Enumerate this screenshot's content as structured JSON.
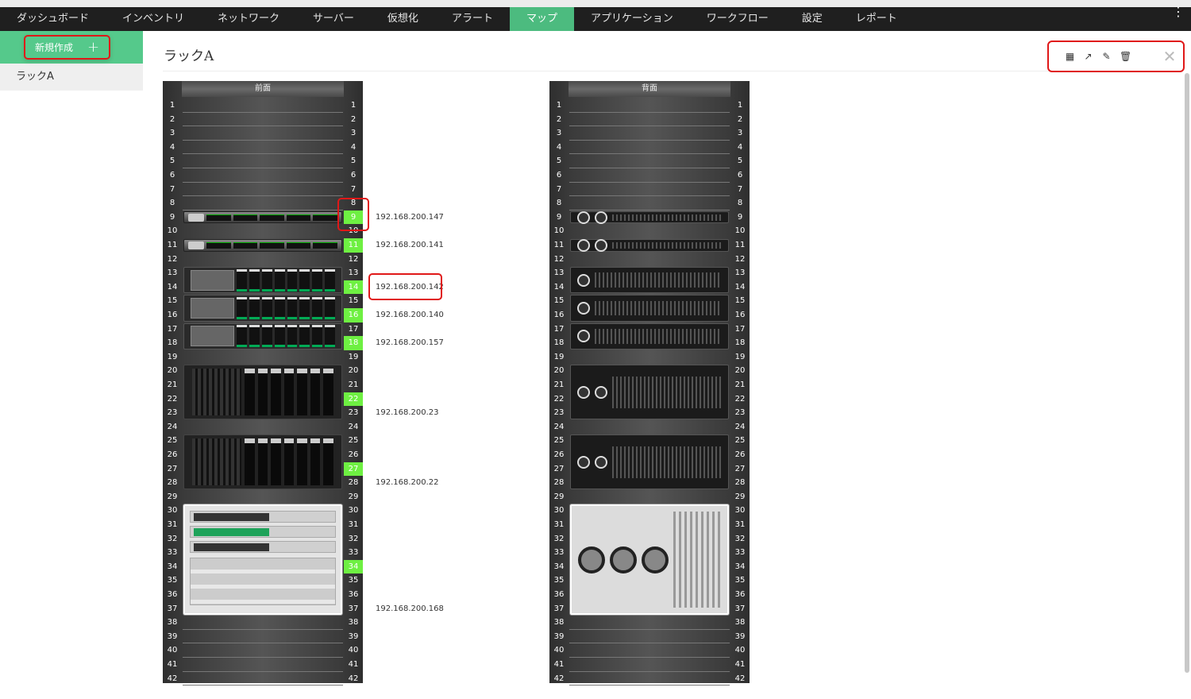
{
  "nav": {
    "items": [
      "ダッシュボード",
      "インベントリ",
      "ネットワーク",
      "サーバー",
      "仮想化",
      "アラート",
      "マップ",
      "アプリケーション",
      "ワークフロー",
      "設定",
      "レポート"
    ],
    "active": "マップ",
    "more_icon": "vertical-ellipsis-icon"
  },
  "sidebar": {
    "new_label": "新規作成",
    "new_icon": "plus-icon",
    "items": [
      "ラックA"
    ]
  },
  "page": {
    "title": "ラックA"
  },
  "toolbar": {
    "icons": [
      "grid-icon",
      "expand-arrow-icon",
      "edit-icon",
      "trash-icon",
      "close-icon"
    ]
  },
  "colors": {
    "accent": "#4cbb7f",
    "highlight": "#6ef042",
    "annotation": "#e01818"
  },
  "racks": [
    {
      "label": "前面",
      "units": 42,
      "highlighted_units": [
        9,
        11,
        14,
        16,
        18,
        22,
        27,
        34
      ],
      "devices": [
        {
          "start": 9,
          "size": 1,
          "type": "1u",
          "ip": "192.168.200.147",
          "ip_unit": 9
        },
        {
          "start": 11,
          "size": 1,
          "type": "1u",
          "ip": "192.168.200.141",
          "ip_unit": 11
        },
        {
          "start": 13,
          "size": 2,
          "type": "2u",
          "ip": "192.168.200.142",
          "ip_unit": 14
        },
        {
          "start": 15,
          "size": 2,
          "type": "2u",
          "ip": "192.168.200.140",
          "ip_unit": 16
        },
        {
          "start": 17,
          "size": 2,
          "type": "2u",
          "ip": "192.168.200.157",
          "ip_unit": 18
        },
        {
          "start": 20,
          "size": 4,
          "type": "4u",
          "ip": "192.168.200.23",
          "ip_unit": 23
        },
        {
          "start": 25,
          "size": 4,
          "type": "4u",
          "ip": "192.168.200.22",
          "ip_unit": 28
        },
        {
          "start": 30,
          "size": 8,
          "type": "8u",
          "ip": "192.168.200.168",
          "ip_unit": 37
        }
      ]
    },
    {
      "label": "背面",
      "units": 42,
      "highlighted_units": [],
      "devices": [
        {
          "start": 9,
          "size": 1,
          "type": "r1"
        },
        {
          "start": 11,
          "size": 1,
          "type": "r1"
        },
        {
          "start": 13,
          "size": 2,
          "type": "r2"
        },
        {
          "start": 15,
          "size": 2,
          "type": "r2"
        },
        {
          "start": 17,
          "size": 2,
          "type": "r2"
        },
        {
          "start": 20,
          "size": 4,
          "type": "r4"
        },
        {
          "start": 25,
          "size": 4,
          "type": "r4"
        },
        {
          "start": 30,
          "size": 8,
          "type": "r8"
        }
      ]
    }
  ]
}
